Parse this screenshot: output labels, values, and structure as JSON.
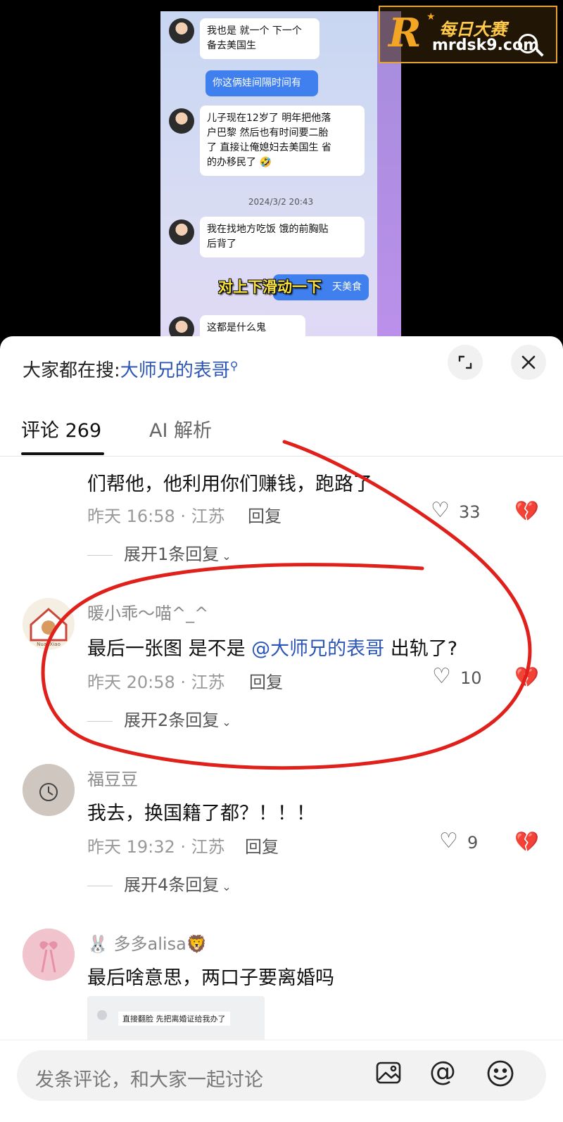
{
  "video": {
    "chat": {
      "msg1": "我也是 就一个 下一个\n备去美国生",
      "msg2_me": "你这俩娃间隔时间有",
      "msg3": "儿子现在12岁了 明年把他落\n户巴黎 然后也有时间要二胎\n了 直接让俺媳妇去美国生 省\n的办移民了",
      "timestamp": "2024/3/2 20:43",
      "msg4": "我在找地方吃饭 饿的前胸贴\n后背了",
      "msg5_me": "天美食",
      "msg6": "这都是什么鬼"
    },
    "caption": "对上下滑动一下",
    "logo": {
      "letter": "R",
      "cn": "每日大赛",
      "url": "mrdsk9.com"
    }
  },
  "sheet": {
    "search_prefix": "大家都在搜:",
    "search_link": "大师兄的表哥",
    "tabs": {
      "comments": "评论 269",
      "ai": "AI 解析"
    },
    "comments": [
      {
        "body": "们帮他，他利用你们赚钱，跑路了",
        "meta": "昨天 16:58 · 江苏",
        "reply": "回复",
        "likes": "33",
        "expand": "展开1条回复"
      },
      {
        "name": "暖小乖～喵^_^",
        "body_before": "最后一张图 是不是 ",
        "mention": "@大师兄的表哥",
        "body_after": " 出轨了?",
        "meta": "昨天 20:58 · 江苏",
        "reply": "回复",
        "likes": "10",
        "expand": "展开2条回复"
      },
      {
        "name": "福豆豆",
        "body": "我去，换国籍了都？！！！",
        "meta": "昨天 19:32 · 江苏",
        "reply": "回复",
        "likes": "9",
        "expand": "展开4条回复"
      },
      {
        "name": "多多alisa",
        "name_prefix_emoji": "🐰",
        "name_suffix_emoji": "🦁",
        "body": "最后啥意思，两口子要离婚吗",
        "image_text": "直接翻脸 先把离婚证给我办了"
      }
    ]
  },
  "input_bar": {
    "placeholder": "发条评论，和大家一起讨论"
  },
  "colors": {
    "mention": "#2c55b8",
    "annotation": "#e0201b",
    "logo_orange": "#f2a623"
  },
  "icons": [
    "expand-icon",
    "close-icon",
    "heart-icon",
    "broken-heart-icon",
    "image-icon",
    "at-icon",
    "emoji-icon",
    "search-small-icon",
    "magnifier-icon"
  ]
}
